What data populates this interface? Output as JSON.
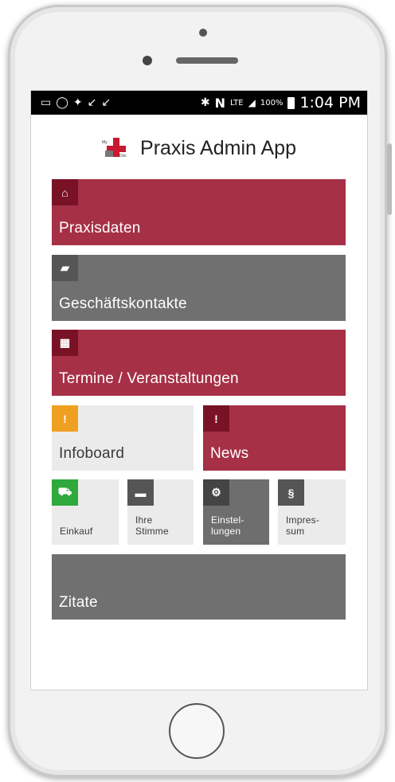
{
  "status_bar": {
    "battery_percent": "100%",
    "time": "1:04 PM",
    "network": "LTE",
    "left_icons": [
      "message-icon",
      "whatsapp-icon",
      "twitter-icon",
      "missed-call-icon",
      "missed-call-icon"
    ],
    "right_icons": [
      "bluetooth-icon",
      "nfc-icon",
      "signal-icon",
      "battery-icon"
    ]
  },
  "header": {
    "title": "Praxis Admin App",
    "logo_text_top": "My",
    "logo_text_bottom": "Doc"
  },
  "tiles": {
    "praxisdaten": {
      "label": "Praxisdaten",
      "icon": "home-icon",
      "icon_glyph": "⌂"
    },
    "geschaeftskontakte": {
      "label": "Geschäftskontakte",
      "icon": "contacts-icon",
      "icon_glyph": "▰"
    },
    "termine": {
      "label": "Termine / Veranstaltungen",
      "icon": "calendar-icon",
      "icon_glyph": "▦"
    },
    "infoboard": {
      "label": "Infoboard",
      "icon": "alert-icon",
      "icon_glyph": "!"
    },
    "news": {
      "label": "News",
      "icon": "alert-icon",
      "icon_glyph": "!"
    },
    "einkauf": {
      "label": "Einkauf",
      "icon": "cart-icon",
      "icon_glyph": "⛟"
    },
    "ihre_stimme_1": {
      "label": "Ihre"
    },
    "ihre_stimme_2": {
      "label": "Stimme"
    },
    "ihre_stimme_icon": {
      "icon": "comment-icon",
      "icon_glyph": "▬"
    },
    "einstellungen_1": {
      "label": "Einstel-"
    },
    "einstellungen_2": {
      "label": "lungen"
    },
    "einstellungen_icon": {
      "icon": "gear-icon",
      "icon_glyph": "⚙"
    },
    "impressum_1": {
      "label": "Impres-"
    },
    "impressum_2": {
      "label": "sum"
    },
    "impressum_icon": {
      "icon": "paragraph-icon",
      "icon_glyph": "§"
    },
    "zitate": {
      "label": "Zitate"
    }
  },
  "colors": {
    "accent_red": "#a63046",
    "accent_red_dark": "#7a1226",
    "tile_gray": "#707070",
    "tile_light": "#ebebeb",
    "infoboard_icon": "#f0a020",
    "einkauf_icon": "#2fa83c"
  }
}
